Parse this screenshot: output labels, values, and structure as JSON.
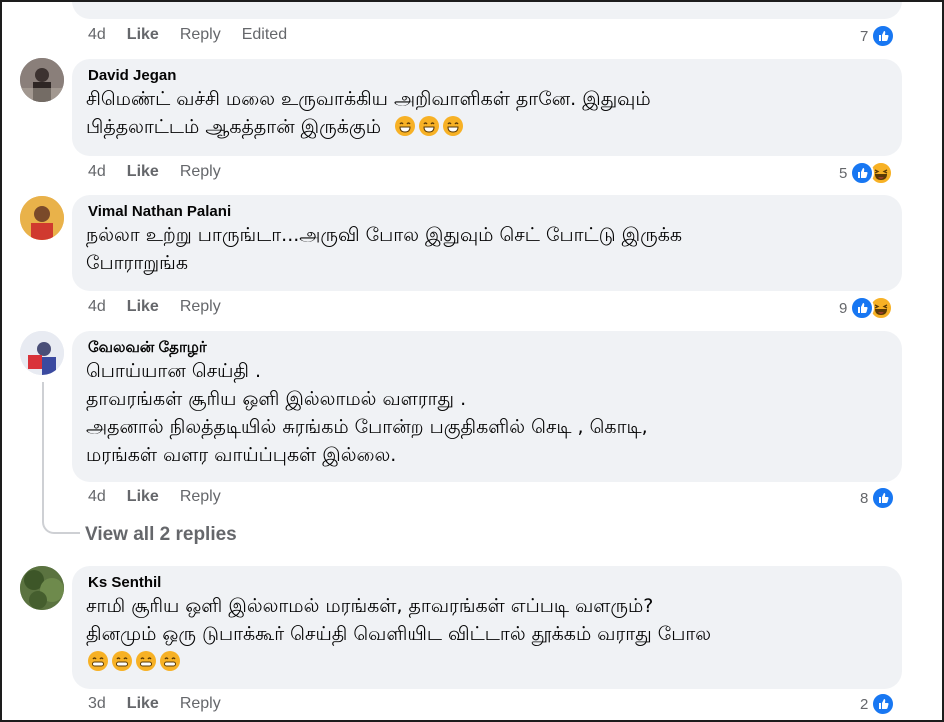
{
  "top_comment": {
    "partial_text": "",
    "time": "4d",
    "like": "Like",
    "reply": "Reply",
    "edited": "Edited",
    "reaction_count": "7",
    "reactions": [
      "like-icon"
    ]
  },
  "comments": [
    {
      "author": "David Jegan",
      "lines": [
        "சிமெண்ட் வச்சி மலை உருவாக்கிய அறிவாளிகள் தானே. இதுவும்",
        "பித்தலாட்டம் ஆகத்தான் இருக்கும்"
      ],
      "emoji_count": 3,
      "time": "4d",
      "like": "Like",
      "reply": "Reply",
      "reaction_count": "5",
      "reactions": [
        "like-icon",
        "laugh-icon"
      ]
    },
    {
      "author": "Vimal Nathan Palani",
      "lines": [
        "நல்லா உற்று பாருங்டா...அருவி போல இதுவும் செட் போட்டு இருக்க",
        "போராறுங்க"
      ],
      "time": "4d",
      "like": "Like",
      "reply": "Reply",
      "reaction_count": "9",
      "reactions": [
        "like-icon",
        "laugh-icon"
      ]
    },
    {
      "author": "வேலவன் தோழர்",
      "lines": [
        "பொய்யான செய்தி .",
        "தாவரங்கள் சூரிய ஒளி இல்லாமல் வளராது .",
        "அதனால் நிலத்தடியில் சுரங்கம் போன்ற பகுதிகளில் செடி , கொடி,",
        "மரங்கள் வளர வாய்ப்புகள் இல்லை."
      ],
      "time": "4d",
      "like": "Like",
      "reply": "Reply",
      "reaction_count": "8",
      "reactions": [
        "like-icon"
      ],
      "view_replies": "View all 2 replies"
    },
    {
      "author": "Ks Senthil",
      "lines": [
        "சாமி சூரிய ஒளி இல்லாமல் மரங்கள், தாவரங்கள் எப்படி வளரும்?",
        "தினமும் ஒரு டுபாக்கூர் செய்தி வெளியிட விட்டால் தூக்கம் வராது போல"
      ],
      "emoji_count": 4,
      "time": "3d",
      "like": "Like",
      "reply": "Reply",
      "reaction_count": "2",
      "reactions": [
        "like-icon"
      ]
    }
  ],
  "colors": {
    "bubble": "#f0f2f5",
    "meta_text": "#65676b",
    "like_blue": "#1877f2",
    "emoji_yellow": "#f7b125"
  }
}
